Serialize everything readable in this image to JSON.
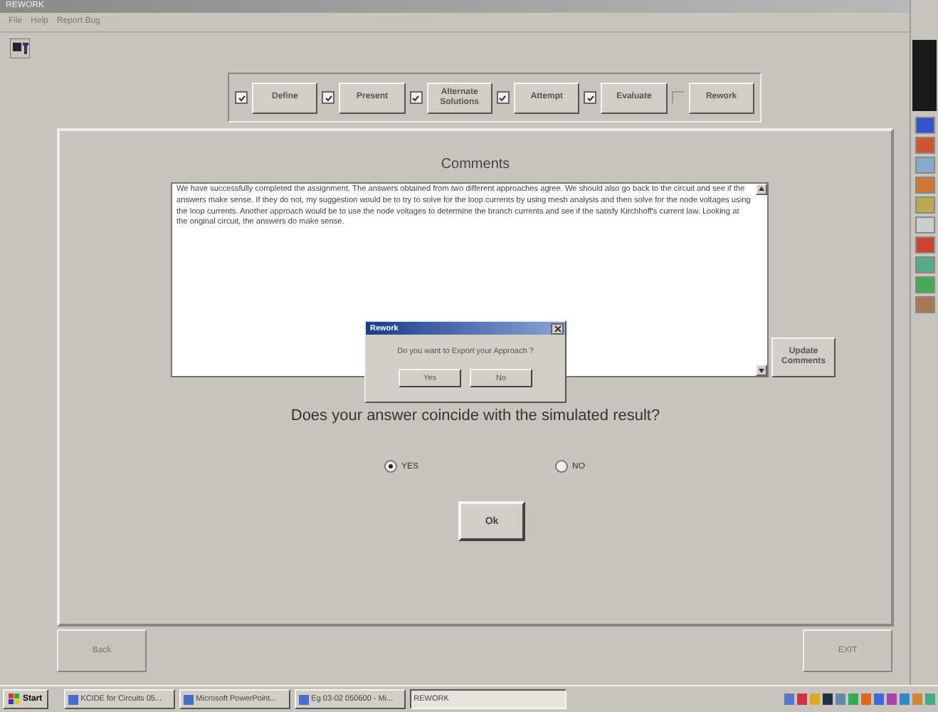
{
  "window": {
    "title": "REWORK"
  },
  "menu": [
    "File",
    "Help",
    "Report Bug"
  ],
  "steps": [
    {
      "label": "Define",
      "checked": true
    },
    {
      "label": "Present",
      "checked": true
    },
    {
      "label": "Alternate Solutions",
      "checked": true
    },
    {
      "label": "Attempt",
      "checked": true
    },
    {
      "label": "Evaluate",
      "checked": true
    },
    {
      "label": "Rework",
      "checked": false
    }
  ],
  "comments": {
    "heading": "Comments",
    "text": "We have successfully completed the assignment.  The answers obtained from two different approaches agree.  We should also go back to the circuit and see if the answers make sense.  If they do not, my suggestion would be to try to solve for the loop currents by using mesh analysis and then solve for the node voltages using the loop currents.  Another approach would be to use the node voltages to determine the branch currents and see if the satisfy Kirchhoff's current law.  Looking at the original circuit, the answers do make sense.",
    "update_button": "Update Comments"
  },
  "question": "Does your answer coincide with the simulated result?",
  "answers": [
    {
      "label": "YES",
      "selected": true
    },
    {
      "label": "NO",
      "selected": false
    }
  ],
  "ok_button": "Ok",
  "back_button": "Back",
  "exit_button": "EXIT",
  "dialog": {
    "title": "Rework",
    "message": "Do you want to Export your Approach ?",
    "buttons": [
      "Yes",
      "No"
    ]
  },
  "taskbar": {
    "start": "Start",
    "tasks": [
      {
        "label": "KCIDE for Circuits 05...",
        "selected": false
      },
      {
        "label": "Microsoft PowerPoint...",
        "selected": false
      },
      {
        "label": "Eg 03-02 050600 - Mi...",
        "selected": false
      },
      {
        "label": "REWORK",
        "selected": true
      }
    ]
  }
}
